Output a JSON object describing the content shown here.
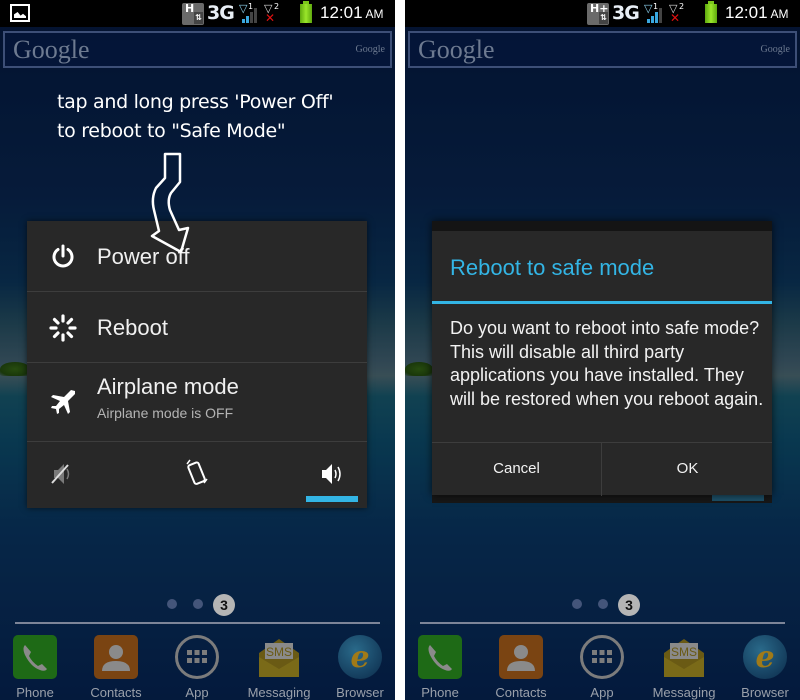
{
  "status_bar": {
    "network_type": "3G",
    "data_left": "H",
    "data_right": "H+",
    "sim1_label": "1",
    "sim2_label": "2",
    "time": "12:01",
    "ampm": "AM"
  },
  "google_widget": {
    "logo": "Google",
    "small_logo": "Google"
  },
  "annotation": {
    "line1": "tap and long press 'Power Off'",
    "line2": "to reboot to \"Safe Mode\""
  },
  "power_menu": {
    "items": [
      {
        "label": "Power off",
        "icon": "power-icon"
      },
      {
        "label": "Reboot",
        "icon": "reboot-icon"
      },
      {
        "label": "Airplane mode",
        "sublabel": "Airplane mode is OFF",
        "icon": "airplane-icon"
      }
    ],
    "sound_modes": [
      "silent",
      "vibrate",
      "sound"
    ],
    "selected_sound_mode": "sound",
    "accent_color": "#33b5e5"
  },
  "dialog": {
    "title": "Reboot to safe mode",
    "message": "Do you want to reboot into safe mode? This will disable all third party applications you have installed. They will be restored when you reboot again.",
    "cancel_label": "Cancel",
    "ok_label": "OK",
    "accent_color": "#33b5e5"
  },
  "home": {
    "current_page": "3",
    "dock": [
      {
        "label": "Phone",
        "icon": "phone-icon"
      },
      {
        "label": "Contacts",
        "icon": "contacts-icon"
      },
      {
        "label": "App",
        "icon": "apps-grid-icon"
      },
      {
        "label": "Messaging",
        "icon": "sms-icon",
        "icon_text": "SMS"
      },
      {
        "label": "Browser",
        "icon": "browser-icon",
        "icon_text": "e"
      }
    ]
  }
}
